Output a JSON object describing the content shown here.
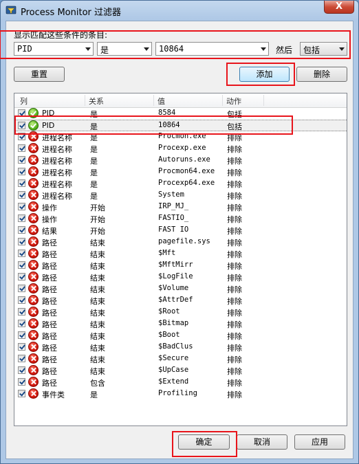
{
  "window": {
    "title": "Process Monitor 过滤器",
    "close_label": "X"
  },
  "condition": {
    "label": "显示匹配这些条件的条目:",
    "column": "PID",
    "relation": "是",
    "value": "10864",
    "then_label": "然后",
    "action": "包括"
  },
  "buttons": {
    "reset": "重置",
    "add": "添加",
    "remove": "删除",
    "ok": "确定",
    "cancel": "取消",
    "apply": "应用"
  },
  "list": {
    "headers": [
      "列",
      "关系",
      "值",
      "动作"
    ],
    "rows": [
      {
        "icon": "include",
        "col": "PID",
        "rel": "是",
        "val": "8584",
        "act": "包括"
      },
      {
        "icon": "include",
        "col": "PID",
        "rel": "是",
        "val": "10864",
        "act": "包括"
      },
      {
        "icon": "exclude",
        "col": "进程名称",
        "rel": "是",
        "val": "Procmon.exe",
        "act": "排除"
      },
      {
        "icon": "exclude",
        "col": "进程名称",
        "rel": "是",
        "val": "Procexp.exe",
        "act": "排除"
      },
      {
        "icon": "exclude",
        "col": "进程名称",
        "rel": "是",
        "val": "Autoruns.exe",
        "act": "排除"
      },
      {
        "icon": "exclude",
        "col": "进程名称",
        "rel": "是",
        "val": "Procmon64.exe",
        "act": "排除"
      },
      {
        "icon": "exclude",
        "col": "进程名称",
        "rel": "是",
        "val": "Procexp64.exe",
        "act": "排除"
      },
      {
        "icon": "exclude",
        "col": "进程名称",
        "rel": "是",
        "val": "System",
        "act": "排除"
      },
      {
        "icon": "exclude",
        "col": "操作",
        "rel": "开始",
        "val": "IRP_MJ_",
        "act": "排除"
      },
      {
        "icon": "exclude",
        "col": "操作",
        "rel": "开始",
        "val": "FASTIO_",
        "act": "排除"
      },
      {
        "icon": "exclude",
        "col": "结果",
        "rel": "开始",
        "val": "FAST IO",
        "act": "排除"
      },
      {
        "icon": "exclude",
        "col": "路径",
        "rel": "结束",
        "val": "pagefile.sys",
        "act": "排除"
      },
      {
        "icon": "exclude",
        "col": "路径",
        "rel": "结束",
        "val": "$Mft",
        "act": "排除"
      },
      {
        "icon": "exclude",
        "col": "路径",
        "rel": "结束",
        "val": "$MftMirr",
        "act": "排除"
      },
      {
        "icon": "exclude",
        "col": "路径",
        "rel": "结束",
        "val": "$LogFile",
        "act": "排除"
      },
      {
        "icon": "exclude",
        "col": "路径",
        "rel": "结束",
        "val": "$Volume",
        "act": "排除"
      },
      {
        "icon": "exclude",
        "col": "路径",
        "rel": "结束",
        "val": "$AttrDef",
        "act": "排除"
      },
      {
        "icon": "exclude",
        "col": "路径",
        "rel": "结束",
        "val": "$Root",
        "act": "排除"
      },
      {
        "icon": "exclude",
        "col": "路径",
        "rel": "结束",
        "val": "$Bitmap",
        "act": "排除"
      },
      {
        "icon": "exclude",
        "col": "路径",
        "rel": "结束",
        "val": "$Boot",
        "act": "排除"
      },
      {
        "icon": "exclude",
        "col": "路径",
        "rel": "结束",
        "val": "$BadClus",
        "act": "排除"
      },
      {
        "icon": "exclude",
        "col": "路径",
        "rel": "结束",
        "val": "$Secure",
        "act": "排除"
      },
      {
        "icon": "exclude",
        "col": "路径",
        "rel": "结束",
        "val": "$UpCase",
        "act": "排除"
      },
      {
        "icon": "exclude",
        "col": "路径",
        "rel": "包含",
        "val": "$Extend",
        "act": "排除"
      },
      {
        "icon": "exclude",
        "col": "事件类",
        "rel": "是",
        "val": "Profiling",
        "act": "排除"
      }
    ]
  },
  "colors": {
    "annotation": "#e8141b",
    "include_icon": "#58b21c",
    "exclude_icon": "#d1170c"
  }
}
